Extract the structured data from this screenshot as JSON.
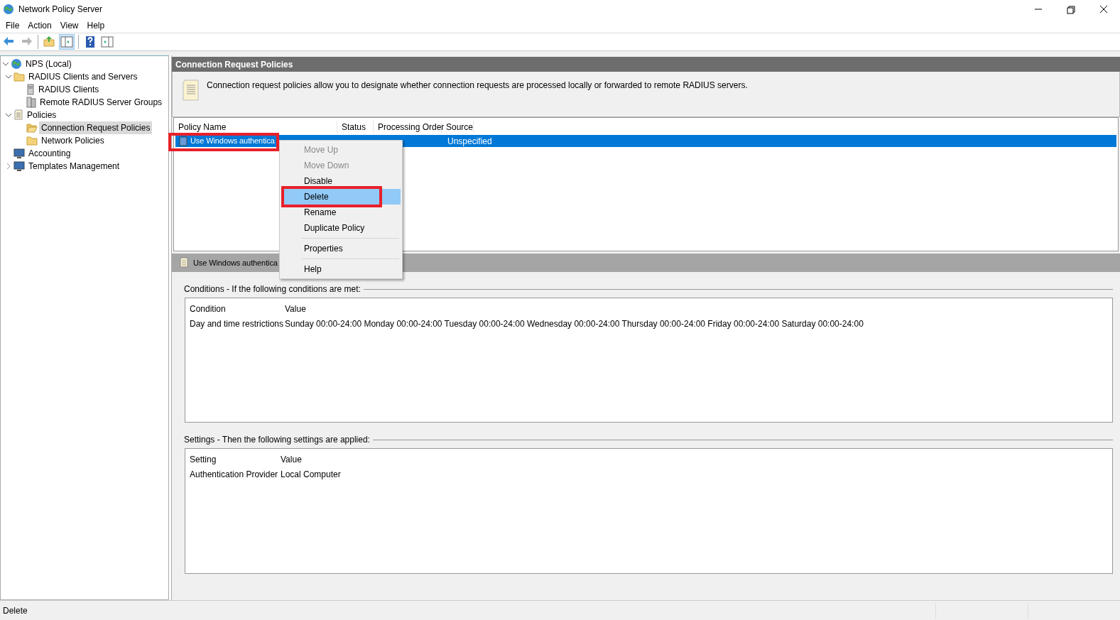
{
  "window": {
    "title": "Network Policy Server"
  },
  "menu": [
    "File",
    "Action",
    "View",
    "Help"
  ],
  "toolbar": [
    {
      "kind": "back",
      "disabled": false
    },
    {
      "kind": "forward",
      "disabled": true
    },
    {
      "kind": "sep"
    },
    {
      "kind": "up",
      "disabled": false
    },
    {
      "kind": "tree",
      "selected": true
    },
    {
      "kind": "sep"
    },
    {
      "kind": "help",
      "selected": false
    },
    {
      "kind": "pane",
      "selected": false
    }
  ],
  "tree": [
    {
      "label": "NPS (Local)",
      "expanded": true,
      "selected": false,
      "children": [
        {
          "label": "RADIUS Clients and Servers",
          "expanded": true,
          "selected": false,
          "children": [
            {
              "label": "RADIUS Clients",
              "selected": false
            },
            {
              "label": "Remote RADIUS Server Groups",
              "selected": false
            }
          ]
        },
        {
          "label": "Policies",
          "expanded": true,
          "selected": false,
          "children": [
            {
              "label": "Connection Request Policies",
              "selected": true
            },
            {
              "label": "Network Policies",
              "selected": false
            }
          ]
        },
        {
          "label": "Accounting",
          "selected": false
        },
        {
          "label": "Templates Management",
          "expanded": false,
          "selected": false
        }
      ]
    }
  ],
  "panel": {
    "title": "Connection Request Policies",
    "description": "Connection request policies allow you to designate whether connection requests are processed locally or forwarded to remote RADIUS servers."
  },
  "policies": {
    "columns": [
      "Policy Name",
      "Status",
      "Processing Order",
      "Source"
    ],
    "rows": [
      {
        "name": "Use Windows authentica",
        "source": "Unspecified",
        "selected": true,
        "highlighted": true
      }
    ]
  },
  "context_menu": [
    {
      "kind": "item",
      "label": "Move Up",
      "disabled": true,
      "selected": false,
      "highlighted": false
    },
    {
      "kind": "item",
      "label": "Move Down",
      "disabled": true,
      "selected": false,
      "highlighted": false
    },
    {
      "kind": "item",
      "label": "Disable",
      "disabled": false,
      "selected": false,
      "highlighted": false
    },
    {
      "kind": "item",
      "label": "Delete",
      "disabled": false,
      "selected": true,
      "highlighted": true
    },
    {
      "kind": "item",
      "label": "Rename",
      "disabled": false,
      "selected": false,
      "highlighted": false
    },
    {
      "kind": "item",
      "label": "Duplicate Policy",
      "disabled": false,
      "selected": false,
      "highlighted": false
    },
    {
      "kind": "separator"
    },
    {
      "kind": "item",
      "label": "Properties",
      "disabled": false,
      "selected": false,
      "highlighted": false
    },
    {
      "kind": "separator"
    },
    {
      "kind": "item",
      "label": "Help",
      "disabled": false,
      "selected": false,
      "highlighted": false
    }
  ],
  "details": {
    "title": "Use Windows authentica",
    "sections": [
      {
        "heading": "Conditions - If the following conditions are met:",
        "columns": [
          "Condition",
          "Value"
        ],
        "rows": [
          [
            "Day and time restrictions",
            "Sunday 00:00-24:00 Monday 00:00-24:00 Tuesday 00:00-24:00 Wednesday 00:00-24:00 Thursday 00:00-24:00 Friday 00:00-24:00 Saturday 00:00-24:00"
          ]
        ]
      },
      {
        "heading": "Settings - Then the following settings are applied:",
        "columns": [
          "Setting",
          "Value"
        ],
        "rows": [
          [
            "Authentication Provider",
            "Local Computer"
          ]
        ]
      }
    ]
  },
  "status_bar": "Delete"
}
